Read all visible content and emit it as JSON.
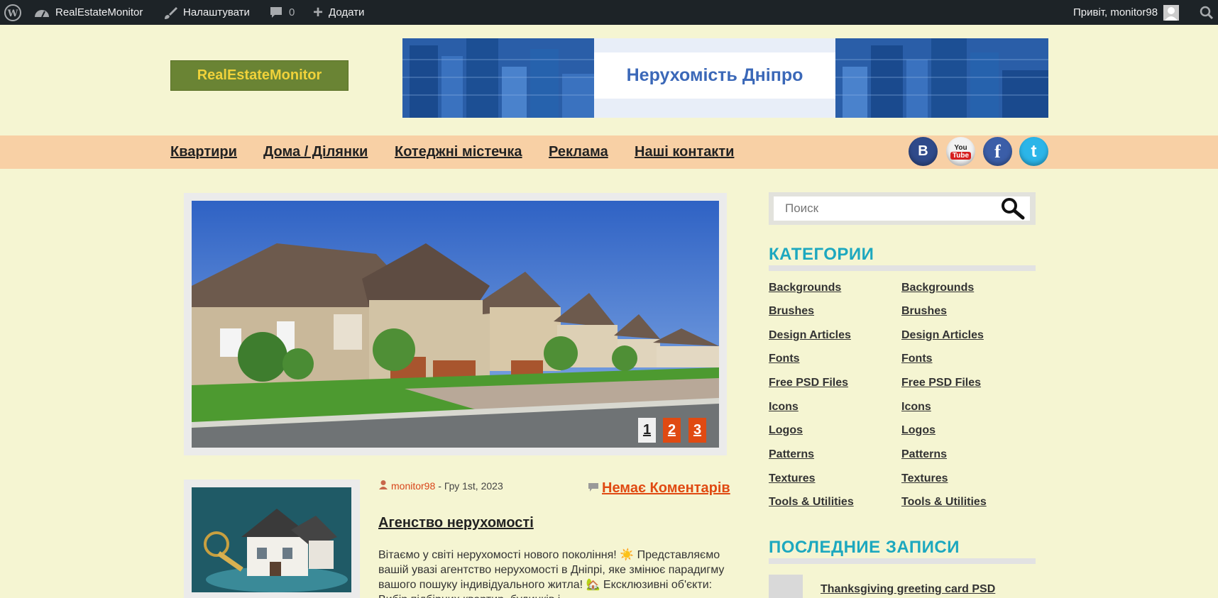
{
  "adminbar": {
    "site_name": "RealEstateMonitor",
    "customize": "Налаштувати",
    "comments_count": "0",
    "new_label": "Додати",
    "greeting": "Привіт, monitor98"
  },
  "header": {
    "logo_text": "RealEstateMonitor",
    "banner_text": "Нерухомість Дніпро"
  },
  "nav": {
    "items": [
      "Квартири",
      "Дома / Ділянки",
      "Котеджні містечка",
      "Реклама",
      "Наші контакти"
    ],
    "social": [
      "B",
      "You Tube",
      "f",
      "t"
    ]
  },
  "slider": {
    "pages": [
      "1",
      "2",
      "3"
    ],
    "active_page": 1
  },
  "post": {
    "author": "monitor98",
    "date": "- Гру 1st, 2023",
    "comments": "Немає Коментарів",
    "title": "Агенство нерухомості",
    "excerpt": "Вітаємо у світі нерухомості нового покоління! ☀️ Представляємо вашій увазі агентство нерухомості в Дніпрі, яке змінює парадигму вашого пошуку індивідуального житла! 🏡 Ексклюзивні об'єкти: Вибір підбірних квартир, будинків і"
  },
  "sidebar": {
    "search_placeholder": "Поиск",
    "categories_title": "КАТЕГОРИИ",
    "categories_left": [
      "Backgrounds",
      "Brushes",
      "Design Articles",
      "Fonts",
      "Free PSD Files",
      "Icons",
      "Logos",
      "Patterns",
      "Textures",
      "Tools & Utilities"
    ],
    "categories_right": [
      "Backgrounds",
      "Brushes",
      "Design Articles",
      "Fonts",
      "Free PSD Files",
      "Icons",
      "Logos",
      "Patterns",
      "Textures",
      "Tools & Utilities"
    ],
    "recent_title": "ПОСЛЕДНИЕ ЗАПИСИ",
    "recent_posts": [
      "Thanksgiving greeting card PSD"
    ]
  },
  "colors": {
    "page_bg": "#f5f5d2",
    "adminbar_bg": "#1d2327",
    "nav_bg": "#f8d0a5",
    "accent_orange": "#e04a12",
    "widget_title": "#1da8bf",
    "logo_bg": "#6a8434",
    "logo_text": "#f0d23a"
  }
}
